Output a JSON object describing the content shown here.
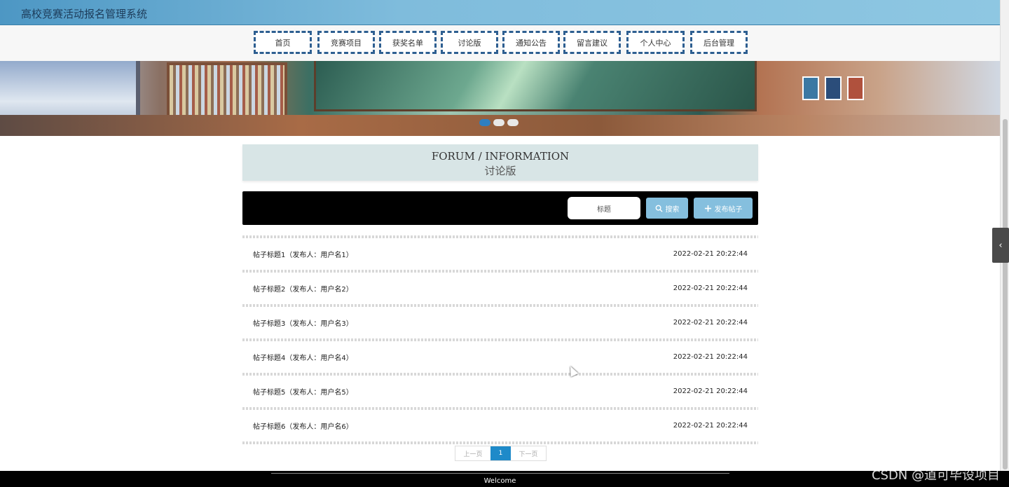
{
  "app": {
    "title": "高校竞赛活动报名管理系统"
  },
  "nav": {
    "items": [
      {
        "label": "首页"
      },
      {
        "label": "竞赛项目"
      },
      {
        "label": "获奖名单"
      },
      {
        "label": "讨论版"
      },
      {
        "label": "通知公告"
      },
      {
        "label": "留言建议"
      },
      {
        "label": "个人中心"
      },
      {
        "label": "后台管理"
      }
    ]
  },
  "banner": {
    "slide_count": 3,
    "active_slide": 1
  },
  "section": {
    "title_en": "FORUM / INFORMATION",
    "title_cn": "讨论版"
  },
  "search": {
    "placeholder": "标题",
    "search_label": "搜索",
    "post_label": "发布帖子",
    "search_icon": "search-icon",
    "post_icon": "plus-icon"
  },
  "posts": [
    {
      "title": "帖子标题1（发布人：用户名1）",
      "time": "2022-02-21 20:22:44"
    },
    {
      "title": "帖子标题2（发布人：用户名2）",
      "time": "2022-02-21 20:22:44"
    },
    {
      "title": "帖子标题3（发布人：用户名3）",
      "time": "2022-02-21 20:22:44"
    },
    {
      "title": "帖子标题4（发布人：用户名4）",
      "time": "2022-02-21 20:22:44"
    },
    {
      "title": "帖子标题5（发布人：用户名5）",
      "time": "2022-02-21 20:22:44"
    },
    {
      "title": "帖子标题6（发布人：用户名6）",
      "time": "2022-02-21 20:22:44"
    }
  ],
  "pager": {
    "prev": "上一页",
    "current": "1",
    "next": "下一页"
  },
  "footer": {
    "text": "Welcome"
  },
  "watermark": "CSDN @道可毕设项目",
  "side_tab": {
    "icon": "chevron-left-icon",
    "glyph": "‹"
  },
  "colors": {
    "header": "#7fbcdc",
    "nav_border": "#2e5f91",
    "button": "#85bfde",
    "pager_active": "#1e8ac9"
  }
}
